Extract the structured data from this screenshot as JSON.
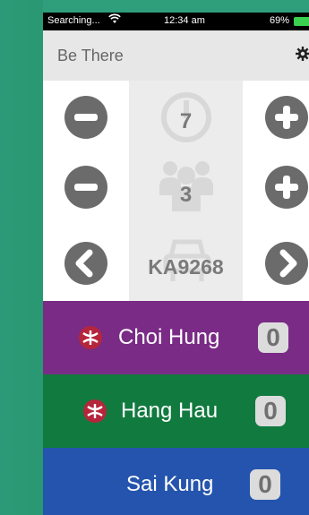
{
  "status_bar": {
    "carrier": "Searching...",
    "wifi_icon": "wifi-icon",
    "time": "12:34 am",
    "battery": "69%",
    "battery_color": "#3ad150"
  },
  "header": {
    "title": "Be There",
    "settings_icon": "gear-icon"
  },
  "controls": {
    "minutes": "7",
    "people": "3",
    "bus_route": "KA9268",
    "accent": "#6b6b6b"
  },
  "stations": [
    {
      "name": "Choi Hung",
      "count": "0",
      "color": "#7a2b86",
      "mtr": true
    },
    {
      "name": "Hang Hau",
      "count": "0",
      "color": "#117a3f",
      "mtr": true
    },
    {
      "name": "Sai Kung",
      "count": "0",
      "color": "#2454ad",
      "mtr": false
    }
  ]
}
